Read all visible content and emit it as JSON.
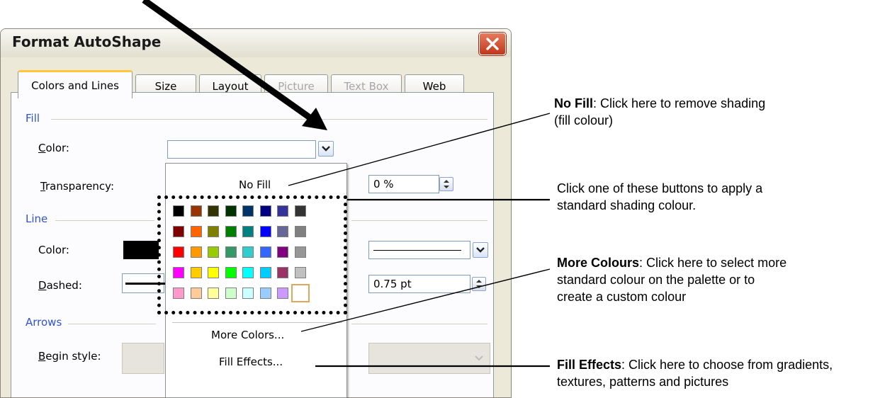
{
  "dialog": {
    "title": "Format AutoShape",
    "close_icon": "close-icon",
    "tabs": [
      {
        "label": "Colors and Lines",
        "state": "active"
      },
      {
        "label": "Size",
        "state": "normal"
      },
      {
        "label": "Layout",
        "state": "normal"
      },
      {
        "label": "Picture",
        "state": "disabled"
      },
      {
        "label": "Text Box",
        "state": "disabled"
      },
      {
        "label": "Web",
        "state": "normal"
      }
    ],
    "fill": {
      "section": "Fill",
      "color_label": "Color:",
      "transparency_label": "Transparency:",
      "transparency_value": "0 %"
    },
    "line": {
      "section": "Line",
      "color_label": "Color:",
      "dashed_label": "Dashed:",
      "weight_value": "0.75 pt"
    },
    "arrows": {
      "section": "Arrows",
      "begin_style_label": "Begin style:"
    }
  },
  "dropdown": {
    "no_fill": "No Fill",
    "more_colors": "More Colors...",
    "fill_effects": "Fill Effects...",
    "swatches": [
      [
        "#000000",
        "#993300",
        "#333300",
        "#003300",
        "#003366",
        "#000080",
        "#333399",
        "#333333"
      ],
      [
        "#800000",
        "#ff6600",
        "#808000",
        "#008000",
        "#008080",
        "#0000ff",
        "#666699",
        "#808080"
      ],
      [
        "#ff0000",
        "#ff9900",
        "#99cc00",
        "#339966",
        "#33cccc",
        "#3366ff",
        "#800080",
        "#969696"
      ],
      [
        "#ff00ff",
        "#ffcc00",
        "#ffff00",
        "#00ff00",
        "#00ffff",
        "#00ccff",
        "#993366",
        "#c0c0c0"
      ],
      [
        "#ff99cc",
        "#ffcc99",
        "#ffff99",
        "#ccffcc",
        "#ccffff",
        "#99ccff",
        "#cc99ff",
        "#ffffff"
      ]
    ],
    "selected_swatch": "#ffffff"
  },
  "annotations": {
    "no_fill": {
      "bold": "No Fill",
      "text": ": Click here to remove shading (fill colour)"
    },
    "palette": {
      "text": "Click one of these buttons to apply a standard shading colour."
    },
    "more_colours": {
      "bold": "More Colours",
      "text": ": Click here to select more standard colour on the palette or to create a custom colour"
    },
    "fill_effects": {
      "bold": "Fill Effects",
      "text": ": Click here to choose from gradients, textures, patterns and pictures"
    }
  }
}
